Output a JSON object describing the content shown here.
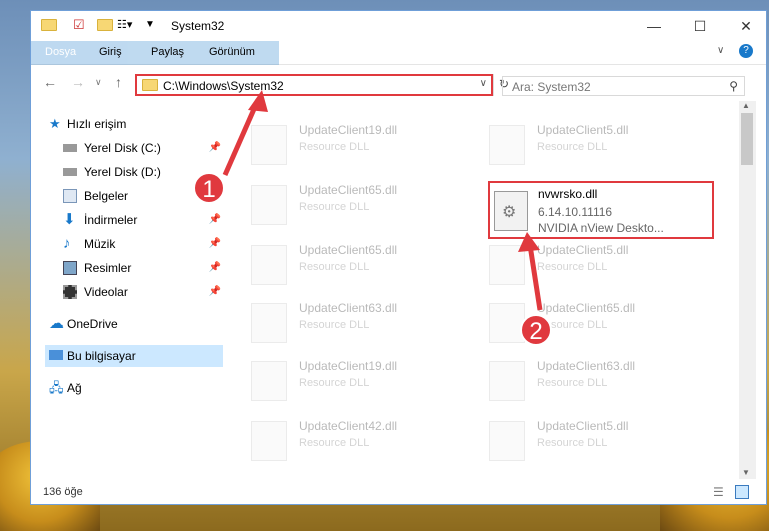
{
  "window": {
    "title": "System32"
  },
  "ribbon": {
    "tabs": [
      "Dosya",
      "Giriş",
      "Paylaş",
      "Görünüm"
    ]
  },
  "address": {
    "path": "C:\\Windows\\System32"
  },
  "search": {
    "placeholder": "Ara: System32"
  },
  "nav": {
    "items": [
      {
        "label": "Hızlı erişim",
        "icon": "star-icon",
        "pinned": false
      },
      {
        "label": "Yerel Disk (C:)",
        "icon": "drive-icon",
        "pinned": true
      },
      {
        "label": "Yerel Disk (D:)",
        "icon": "drive-icon",
        "pinned": false
      },
      {
        "label": "Belgeler",
        "icon": "documents-icon",
        "pinned": true
      },
      {
        "label": "İndirmeler",
        "icon": "download-icon",
        "pinned": true
      },
      {
        "label": "Müzik",
        "icon": "music-icon",
        "pinned": true
      },
      {
        "label": "Resimler",
        "icon": "pictures-icon",
        "pinned": true
      },
      {
        "label": "Videolar",
        "icon": "video-icon",
        "pinned": true
      },
      {
        "label": "OneDrive",
        "icon": "cloud-icon",
        "pinned": false
      },
      {
        "label": "Bu bilgisayar",
        "icon": "computer-icon",
        "pinned": false,
        "selected": true
      },
      {
        "label": "Ağ",
        "icon": "network-icon",
        "pinned": false
      }
    ]
  },
  "files": [
    {
      "name": "UpdateClient19.dll",
      "desc": "Resource DLL"
    },
    {
      "name": "UpdateClient5.dll",
      "desc": "Resource DLL"
    },
    {
      "name": "UpdateClient65.dll",
      "desc": "Resource DLL"
    },
    {
      "name": "UpdateClient65.dll",
      "desc": "Resource DLL"
    },
    {
      "name": "UpdateClient5.dll",
      "desc": "Resource DLL"
    },
    {
      "name": "UpdateClient63.dll",
      "desc": "Resource DLL"
    },
    {
      "name": "UpdateClient65.dll",
      "desc": "Resource DLL"
    },
    {
      "name": "UpdateClient19.dll",
      "desc": "Resource DLL"
    },
    {
      "name": "UpdateClient63.dll",
      "desc": "Resource DLL"
    },
    {
      "name": "UpdateClient42.dll",
      "desc": "Resource DLL"
    },
    {
      "name": "UpdateClient5.dll",
      "desc": "Resource DLL"
    }
  ],
  "target_file": {
    "name": "nvwrsko.dll",
    "version": "6.14.10.11116",
    "desc": "NVIDIA nView Deskto..."
  },
  "status": {
    "count": "136 öğe"
  },
  "markers": [
    "1",
    "2"
  ],
  "colors": {
    "accent": "#1979ca",
    "highlight": "#e0393e"
  }
}
